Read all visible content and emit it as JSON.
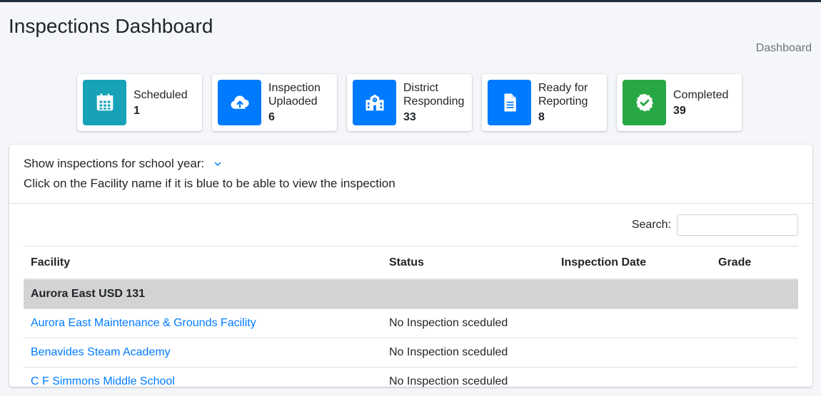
{
  "page": {
    "title": "Inspections Dashboard",
    "breadcrumb": "Dashboard"
  },
  "info_boxes": [
    {
      "label": "Scheduled",
      "value": "1",
      "color": "#17a2b8",
      "icon": "calendar-icon"
    },
    {
      "label": "Inspection Uplaoded",
      "value": "6",
      "color": "#007bff",
      "icon": "cloud-upload-icon"
    },
    {
      "label": "District Responding",
      "value": "33",
      "color": "#007bff",
      "icon": "school-icon"
    },
    {
      "label": "Ready for Reporting",
      "value": "8",
      "color": "#007bff",
      "icon": "document-icon"
    },
    {
      "label": "Completed",
      "value": "39",
      "color": "#28a745",
      "icon": "badge-check-icon"
    }
  ],
  "card": {
    "year_label": "Show inspections for school year:",
    "instruction": "Click on the Facility name if it is blue to be able to view the inspection",
    "search_label": "Search:",
    "search_value": ""
  },
  "table": {
    "columns": [
      "Facility",
      "Status",
      "Inspection Date",
      "Grade"
    ],
    "group": "Aurora East USD 131",
    "rows": [
      {
        "facility": "Aurora East Maintenance & Grounds Facility",
        "status": "No Inspection sceduled",
        "date": "",
        "grade": ""
      },
      {
        "facility": "Benavides Steam Academy",
        "status": "No Inspection sceduled",
        "date": "",
        "grade": ""
      },
      {
        "facility": "C F Simmons Middle School",
        "status": "No Inspection sceduled",
        "date": "",
        "grade": ""
      }
    ]
  }
}
